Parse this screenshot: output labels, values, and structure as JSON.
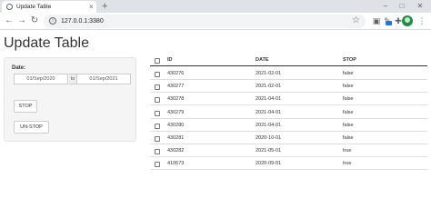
{
  "browser": {
    "tab_title": "Update Table",
    "url": "127.0.0.1:3380"
  },
  "page": {
    "title": "Update Table"
  },
  "filter": {
    "date_label": "Date:",
    "start_date": "01/Sep/2020",
    "separator": "to",
    "end_date": "01/Sep/2021",
    "stop_button": "STOP",
    "unstop_button": "UN-STOP"
  },
  "table": {
    "columns": [
      "ID",
      "DATE",
      "STOP"
    ],
    "rows": [
      {
        "id": "430276",
        "date": "2021-02-01",
        "stop": "false"
      },
      {
        "id": "430277",
        "date": "2021-02-01",
        "stop": "false"
      },
      {
        "id": "430278",
        "date": "2021-04-01",
        "stop": "false"
      },
      {
        "id": "430279",
        "date": "2021-04-01",
        "stop": "false"
      },
      {
        "id": "430280",
        "date": "2021-04-01",
        "stop": "false"
      },
      {
        "id": "430281",
        "date": "2020-10-01",
        "stop": "false"
      },
      {
        "id": "430282",
        "date": "2021-05-01",
        "stop": "true"
      },
      {
        "id": "410673",
        "date": "2020-09-01",
        "stop": "true"
      }
    ]
  }
}
